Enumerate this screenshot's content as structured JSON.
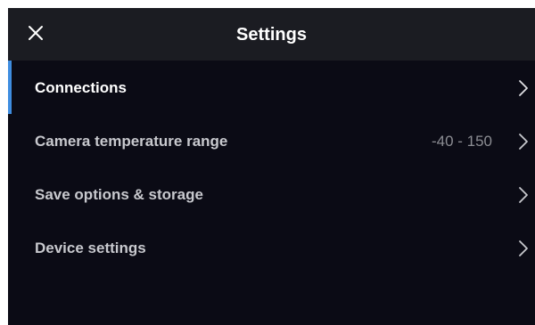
{
  "header": {
    "title": "Settings",
    "close_icon": "close-icon"
  },
  "menu": {
    "items": [
      {
        "label": "Connections",
        "value": "",
        "active": true,
        "icon": "chevron-right-icon"
      },
      {
        "label": "Camera temperature range",
        "value": "-40 - 150",
        "active": false,
        "icon": "chevron-right-icon"
      },
      {
        "label": "Save options & storage",
        "value": "",
        "active": false,
        "icon": "chevron-right-icon"
      },
      {
        "label": "Device settings",
        "value": "",
        "active": false,
        "icon": "chevron-right-icon"
      }
    ]
  },
  "colors": {
    "background": "#0b0b15",
    "header_background": "#1b1c22",
    "accent": "#3f8de0",
    "text_primary": "#ffffff",
    "text_secondary": "#c8c9ce",
    "text_value": "#8c8d93"
  }
}
